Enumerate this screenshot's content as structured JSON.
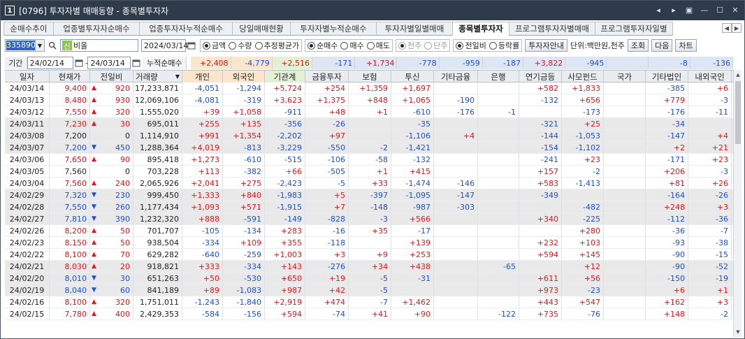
{
  "window": {
    "num": "1",
    "title": "[0796] 투자자별 매매동향 - 종목별투자자",
    "controls": [
      "◂",
      "▸",
      "▣",
      "—",
      "☐",
      "✕"
    ]
  },
  "tabs": [
    "순매수추이",
    "업종별투자자순매수",
    "업종투자자누적순매수",
    "당일매매현황",
    "투자자별누적순매수",
    "투자자별일별매매",
    "종목별투자자",
    "프로그램투자자별매매",
    "프로그램투자자일별"
  ],
  "active_tab": 6,
  "controls": {
    "code": "335890",
    "flag": "신",
    "name": "비올",
    "date": "2024/03/14",
    "radio1": [
      {
        "label": "금액",
        "on": true
      },
      {
        "label": "수량",
        "on": false
      },
      {
        "label": "추정평균가",
        "on": false
      }
    ],
    "radio2": [
      {
        "label": "순매수",
        "on": true
      },
      {
        "label": "매수",
        "on": false
      },
      {
        "label": "매도",
        "on": false
      }
    ],
    "radio3": [
      {
        "label": "천주",
        "on": true
      },
      {
        "label": "단주",
        "on": false
      }
    ],
    "radio4": [
      {
        "label": "전일비",
        "on": true
      },
      {
        "label": "등락률",
        "on": false
      }
    ],
    "guide_button": "투자자안내",
    "unit": "단위:백만원,천주",
    "btn_query": "조회",
    "btn_next": "다음",
    "btn_chart": "차트"
  },
  "period": {
    "label": "기간",
    "from": "24/02/14",
    "sep": "~",
    "to": "24/03/14",
    "cum_label": "누적순매수"
  },
  "summary": [
    "+2,408",
    "-4,779",
    "+2,516",
    "-171",
    "+1,734",
    "-778",
    "-959",
    "-187",
    "+3,822",
    "-945",
    "",
    "-8",
    "-136"
  ],
  "headers": [
    "일자",
    "현재가",
    "전일비",
    "거래량",
    "개인",
    "외국인",
    "기관계",
    "금융투자",
    "보험",
    "투신",
    "기타금융",
    "은행",
    "연기금등",
    "사모펀드",
    "국가",
    "기타법인",
    "내외국인"
  ],
  "rows": [
    [
      "24/03/14",
      "9,400",
      "up",
      "920",
      "17,233,871",
      "-4,051",
      "-1,294",
      "+5,724",
      "+254",
      "+1,359",
      "+1,697",
      "",
      "",
      "+582",
      "+1,833",
      "",
      "-385",
      "+6"
    ],
    [
      "24/03/13",
      "8,480",
      "up",
      "930",
      "12,069,106",
      "-4,081",
      "-319",
      "+3,623",
      "+1,375",
      "+848",
      "+1,065",
      "-190",
      "",
      "-132",
      "+656",
      "",
      "+779",
      "-3"
    ],
    [
      "24/03/12",
      "7,550",
      "up",
      "320",
      "1,555,020",
      "+39",
      "+1,058",
      "-911",
      "+48",
      "+1",
      "-610",
      "-176",
      "-1",
      "",
      "-173",
      "",
      "-176",
      "-11"
    ],
    [
      "24/03/11",
      "7,230",
      "up",
      "30",
      "695,011",
      "+255",
      "+135",
      "-356",
      "-26",
      "",
      "-35",
      "",
      "",
      "-321",
      "+25",
      "",
      "-34",
      ""
    ],
    [
      "24/03/08",
      "7,200",
      "",
      "0",
      "1,114,910",
      "+991",
      "+1,354",
      "-2,202",
      "+97",
      "",
      "-1,106",
      "+4",
      "",
      "-144",
      "-1,053",
      "",
      "-147",
      "+4"
    ],
    [
      "24/03/07",
      "7,200",
      "down",
      "450",
      "1,288,364",
      "+4,019",
      "-813",
      "-3,229",
      "-550",
      "-2",
      "-1,421",
      "",
      "",
      "-154",
      "-1,102",
      "",
      "+2",
      "+21"
    ],
    [
      "24/03/06",
      "7,650",
      "up",
      "90",
      "895,418",
      "+1,273",
      "-610",
      "-515",
      "-106",
      "-58",
      "-132",
      "",
      "",
      "-241",
      "+23",
      "",
      "-171",
      "+23"
    ],
    [
      "24/03/05",
      "7,560",
      "",
      "0",
      "703,228",
      "+113",
      "-382",
      "+66",
      "-505",
      "+1",
      "+415",
      "",
      "",
      "+157",
      "-2",
      "",
      "+206",
      "-3"
    ],
    [
      "24/03/04",
      "7,560",
      "up",
      "240",
      "2,065,926",
      "+2,041",
      "+275",
      "-2,423",
      "-5",
      "+33",
      "-1,474",
      "-146",
      "",
      "+583",
      "-1,413",
      "",
      "+81",
      "+26"
    ],
    [
      "24/02/29",
      "7,320",
      "down",
      "230",
      "999,450",
      "+1,333",
      "+840",
      "-1,983",
      "+5",
      "-397",
      "-1,095",
      "-147",
      "",
      "-349",
      "",
      "",
      "-164",
      "-26"
    ],
    [
      "24/02/28",
      "7,550",
      "down",
      "260",
      "1,177,434",
      "+1,093",
      "+571",
      "-1,915",
      "+7",
      "-148",
      "-987",
      "-303",
      "",
      "",
      "-482",
      "",
      "+248",
      "+3"
    ],
    [
      "24/02/27",
      "7,810",
      "down",
      "390",
      "1,232,320",
      "+888",
      "-591",
      "-149",
      "-828",
      "-3",
      "+566",
      "",
      "",
      "+340",
      "-225",
      "",
      "-112",
      "-36"
    ],
    [
      "24/02/26",
      "8,200",
      "up",
      "50",
      "701,707",
      "-105",
      "-134",
      "+283",
      "-16",
      "+35",
      "-17",
      "",
      "",
      "",
      "+280",
      "",
      "-36",
      "-7"
    ],
    [
      "24/02/23",
      "8,150",
      "up",
      "50",
      "938,504",
      "-334",
      "+109",
      "+355",
      "-118",
      "",
      "+139",
      "",
      "",
      "+232",
      "+103",
      "",
      "-93",
      "-38"
    ],
    [
      "24/02/22",
      "8,100",
      "up",
      "70",
      "629,282",
      "-640",
      "-259",
      "+1,003",
      "+3",
      "+9",
      "+253",
      "",
      "",
      "+594",
      "+145",
      "",
      "-90",
      "-15"
    ],
    [
      "24/02/21",
      "8,030",
      "up",
      "20",
      "918,821",
      "+333",
      "-334",
      "+143",
      "-276",
      "+34",
      "+438",
      "",
      "-65",
      "",
      "+12",
      "",
      "-90",
      "-52"
    ],
    [
      "24/02/20",
      "8,010",
      "down",
      "30",
      "651,263",
      "+50",
      "-530",
      "+650",
      "+19",
      "-5",
      "-31",
      "",
      "",
      "+611",
      "+56",
      "",
      "-150",
      "-19"
    ],
    [
      "24/02/19",
      "8,040",
      "down",
      "60",
      "841,189",
      "+89",
      "-1,083",
      "+987",
      "+42",
      "-5",
      "",
      "",
      "",
      "+973",
      "-23",
      "",
      "+6",
      "+1"
    ],
    [
      "24/02/16",
      "8,100",
      "up",
      "320",
      "1,751,011",
      "-1,243",
      "-1,840",
      "+2,919",
      "+474",
      "-7",
      "+1,462",
      "",
      "",
      "+443",
      "+547",
      "",
      "+162",
      "+3"
    ],
    [
      "24/02/15",
      "7,780",
      "up",
      "400",
      "2,429,353",
      "-584",
      "-156",
      "+594",
      "-74",
      "+41",
      "+90",
      "",
      "-122",
      "+735",
      "-76",
      "",
      "+148",
      "-2"
    ]
  ],
  "shaded_rows": [
    3,
    4,
    5,
    9,
    10,
    11,
    15,
    16,
    17
  ],
  "colors": {
    "red": "#e4171d",
    "blue": "#1f4fd8",
    "title_bg": "#2d3b4b",
    "shade": "#e9e9e9",
    "sum_orange": "#fbe5cc",
    "sum_green": "#e4f0d4",
    "sum_blue": "#dde6f5"
  }
}
